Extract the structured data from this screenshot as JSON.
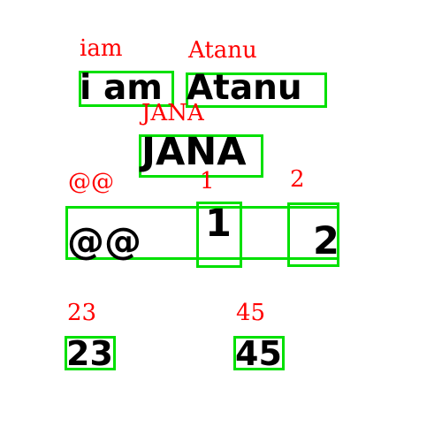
{
  "detections": [
    {
      "label": "iam",
      "text": "i am"
    },
    {
      "label": "Atanu",
      "text": "Atanu"
    },
    {
      "label": "JANA",
      "text": "JANA"
    },
    {
      "label": "@@",
      "text": "@@"
    },
    {
      "label": "1",
      "text": "1"
    },
    {
      "label": "2",
      "text": "2"
    },
    {
      "label": "23",
      "text": "23"
    },
    {
      "label": "45",
      "text": "45"
    }
  ],
  "colors": {
    "label": "#ff0000",
    "box": "#00e000",
    "text": "#000000",
    "background": "#ffffff"
  }
}
